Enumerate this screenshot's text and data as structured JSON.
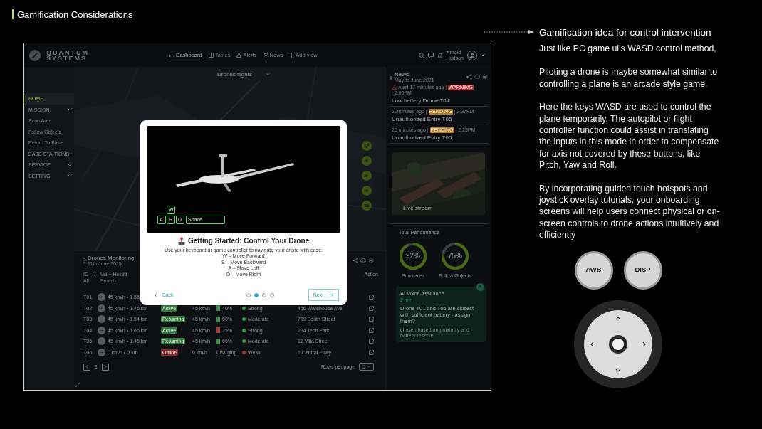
{
  "slide": {
    "title": "Gamification Considerations"
  },
  "app": {
    "brand": [
      "QUANTUM",
      "SYSTEMS"
    ],
    "nav": [
      {
        "label": "Dashboard",
        "kind": "chart",
        "selected": true
      },
      {
        "label": "Tables",
        "kind": "grid",
        "selected": false
      },
      {
        "label": "Alerts",
        "kind": "alert",
        "selected": false
      },
      {
        "label": "News",
        "kind": "bulb",
        "selected": false
      },
      {
        "label": "Add view",
        "kind": "plus",
        "selected": false
      }
    ],
    "user": {
      "name": "Arnold",
      "role": "Hudson"
    },
    "sidebar": [
      {
        "label": "HOME",
        "kind": "top",
        "selected": true
      },
      {
        "label": "MISSION",
        "kind": "group",
        "selected": false
      },
      {
        "label": "Scan Area",
        "kind": "sub",
        "selected": false
      },
      {
        "label": "Follow Objects",
        "kind": "sub",
        "selected": false
      },
      {
        "label": "Return To Base",
        "kind": "sub",
        "selected": false
      },
      {
        "label": "BASE STAITIONS",
        "kind": "group",
        "selected": false
      },
      {
        "label": "SERVICE",
        "kind": "group",
        "selected": false
      },
      {
        "label": "SETTING",
        "kind": "group",
        "selected": false
      }
    ],
    "map": {
      "title": "Drones flights",
      "buttons": [
        {
          "kind": "layers"
        },
        {
          "kind": "target"
        },
        {
          "kind": "target"
        },
        {
          "kind": "target"
        },
        {
          "kind": "map"
        }
      ]
    },
    "monitor": {
      "title": "Drones Monitoring",
      "date": "11th June 2025",
      "columns": [
        {
          "label": "ID",
          "sub": "All"
        },
        {
          "label": "Vel + Height",
          "sub": "Search"
        },
        {
          "label": "Action"
        }
      ],
      "rows": [
        {
          "id": "T01",
          "vel": "45 km/h • 1.56"
        },
        {
          "id": "T02",
          "vel": "45 km/h • 1.45 km",
          "status": {
            "label": "Active",
            "color": "#2f7a3a"
          },
          "speed": "45 km/h",
          "battery": {
            "label": "40%",
            "color": "#3f8a4a"
          },
          "signal": {
            "label": "Strong",
            "color": "#2f9a4a"
          },
          "address": "456 Warehouse Ave"
        },
        {
          "id": "T03",
          "vel": "45 km/h • 1.54 km",
          "status": {
            "label": "Returning",
            "color": "#2f7a3a"
          },
          "speed": "45 km/h",
          "battery": {
            "label": "50%",
            "color": "#3f8a4a"
          },
          "signal": {
            "label": "Moderate",
            "color": "#2f9a4a"
          },
          "address": "789 South Street"
        },
        {
          "id": "T04",
          "vel": "45 km/h • 1.66 km",
          "status": {
            "label": "Active",
            "color": "#2f7a3a"
          },
          "speed": "45 km/h",
          "battery": {
            "label": "25%",
            "color": "#a33a3a"
          },
          "signal": {
            "label": "Strong",
            "color": "#2f9a4a"
          },
          "address": "234 Tech Park"
        },
        {
          "id": "T05",
          "vel": "45 km/h • 1.45 km",
          "status": {
            "label": "Returning",
            "color": "#2f7a3a"
          },
          "speed": "45 km/h",
          "battery": {
            "label": "65%",
            "color": "#3f8a4a"
          },
          "signal": {
            "label": "Moderate",
            "color": "#2f9a4a"
          },
          "address": "12 Villa Street"
        },
        {
          "id": "T06",
          "vel": "0 km/h • 0 km",
          "status": {
            "label": "Offline",
            "color": "#8a2a2a"
          },
          "speed": "0 km/h",
          "battery": {
            "label": "Charging"
          },
          "signal": {
            "label": "Weak",
            "color": "#a33030"
          },
          "address": "1 Central Pkwy"
        }
      ],
      "page": "1",
      "rows_label": "Rows per page",
      "rows_value": "5"
    },
    "news": {
      "title": "News",
      "period": "May to June 2021",
      "items": [
        {
          "kind": "alert",
          "tag": "Alert",
          "ago": "17 minutes ago |",
          "state": {
            "label": "WARNING",
            "color": "#b03030"
          },
          "time": "| 2:00PM",
          "title": "Low bettery Drone T04"
        },
        {
          "kind": "plain",
          "ago": "20minutes ago |",
          "state": {
            "label": "PENDING",
            "color": "#b07a20"
          },
          "time": "| 2:37PM",
          "title": "Unauthorized Entry T05"
        },
        {
          "kind": "plain",
          "ago": "25 minutes ago |",
          "state": {
            "label": "PENDING",
            "color": "#b07a20"
          },
          "time": "| 2:25PM",
          "title": "Unauthorized Entry T05"
        }
      ],
      "stream_label": "Live stream",
      "performance_title": "Total Performance",
      "performance": [
        {
          "value": "92%",
          "label": "Scan area",
          "level": 0.92
        },
        {
          "value": "75%",
          "label": "Follow Objects",
          "level": 0.75
        }
      ],
      "ai": {
        "title": "AI Voice Assitance",
        "time": "2 min",
        "message": "Drone T01 and T05 are closest with sufficient battery - assign them?",
        "note": "chosen based on proximity and battery reserve"
      }
    },
    "modal": {
      "keys": [
        {
          "label": "W",
          "kind": "up"
        },
        {
          "label": "A",
          "kind": "row"
        },
        {
          "label": "S",
          "kind": "row"
        },
        {
          "label": "D",
          "kind": "row"
        },
        {
          "label": "Space",
          "kind": "wide"
        }
      ],
      "title": "Getting Started: Control Your Drone",
      "intro": "Use your keyboard or game controller to navigate your drone with ease:",
      "bullets": [
        "W – Move Forward",
        "S – Move Backward",
        "A – Move Left",
        "D – Move Right"
      ],
      "back": "Back",
      "next": "Next",
      "steps": [
        {
          "selected": false
        },
        {
          "selected": true
        },
        {
          "selected": false
        },
        {
          "selected": false
        }
      ]
    }
  },
  "notes": {
    "heading": "Gamification idea for control intervention",
    "paragraphs": [
      " Just like PC game ui’s WASD control method,",
      "Piloting a drone is maybe somewhat similar to controlling a plane is an arcade style game.",
      "Here the keys WASD are used to control the plane temporarily. The autopilot or flight controller function could assist in translating the inputs in this  mode in order to compensate for axis not covered by these buttons, like Pitch, Yaw and Roll.",
      "By incorporating guided touch hotspots and joystick overlay tutorials, your onboarding screens will help users connect physical or on-screen controls to drone actions intuitively and efficiently"
    ],
    "controller": {
      "buttons": [
        "AWB",
        "DISP"
      ]
    }
  }
}
